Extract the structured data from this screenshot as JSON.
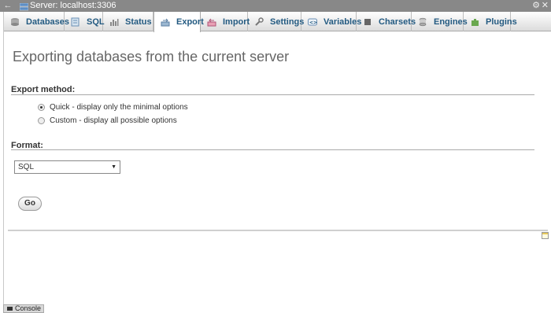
{
  "topbar": {
    "title": "Server: localhost:3306",
    "back_icon": "←",
    "gear_icon": "⚙",
    "close_icon": "✕"
  },
  "tabs": [
    {
      "label": "Databases",
      "icon": "database-icon"
    },
    {
      "label": "SQL",
      "icon": "sql-icon"
    },
    {
      "label": "Status",
      "icon": "status-icon"
    },
    {
      "label": "Export",
      "icon": "export-icon"
    },
    {
      "label": "Import",
      "icon": "import-icon"
    },
    {
      "label": "Settings",
      "icon": "settings-icon"
    },
    {
      "label": "Variables",
      "icon": "variables-icon"
    },
    {
      "label": "Charsets",
      "icon": "charsets-icon"
    },
    {
      "label": "Engines",
      "icon": "engines-icon"
    },
    {
      "label": "Plugins",
      "icon": "plugins-icon"
    }
  ],
  "active_tab": "Export",
  "main": {
    "heading": "Exporting databases from the current server",
    "export_method": {
      "label": "Export method:",
      "options": [
        {
          "label": "Quick - display only the minimal options",
          "checked": true
        },
        {
          "label": "Custom - display all possible options",
          "checked": false
        }
      ]
    },
    "format": {
      "label": "Format:",
      "selected": "SQL",
      "arrow": "▼"
    },
    "go_label": "Go"
  },
  "console_label": "Console"
}
